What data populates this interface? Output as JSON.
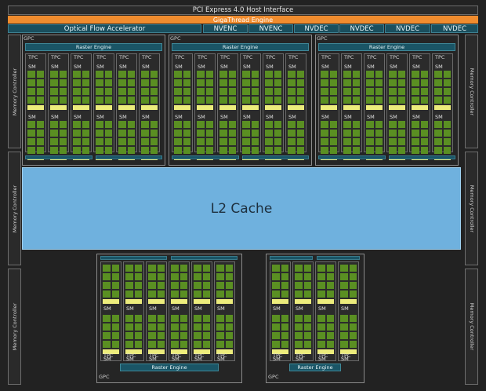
{
  "title": "PCI Express 4.0 Host Interface",
  "gigathread": "GigaThread Engine",
  "optical_flow": "Optical Flow Accelerator",
  "media_units": [
    "NVENC",
    "NVENC",
    "NVDEC",
    "NVDEC",
    "NVDEC",
    "NVDEC"
  ],
  "memory_controller": "Memory Controller",
  "l2_cache": "L2 Cache",
  "gpc_label": "GPC",
  "raster_engine": "Raster Engine",
  "tpc_label": "TPC",
  "sm_label": "SM",
  "colors": {
    "background": "#222222",
    "gigathread": "#f08c2e",
    "engine_blue": "#1a5566",
    "l2_cache": "#6fb1de",
    "cuda_core": "#5a8f22",
    "cache_block": "#ecec7c"
  }
}
